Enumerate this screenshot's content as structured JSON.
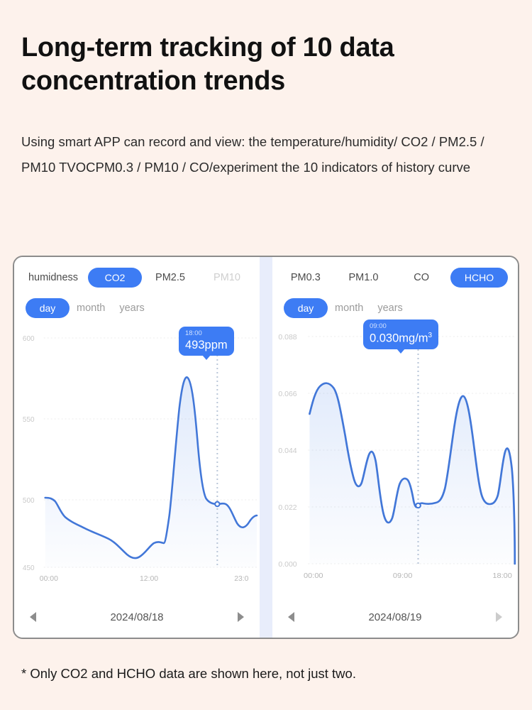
{
  "headline": "Long-term tracking of 10 data concentration trends",
  "subtext": "Using smart APP can record and view: the temperature/humidity/ CO2 / PM2.5 / PM10 TVOCPM0.3 / PM10 / CO/experiment the 10 indicators of history curve",
  "footnote": "* Only CO2 and HCHO data are shown here, not just two.",
  "colors": {
    "accent": "#3d7cf4",
    "curve": "#4277d8",
    "page_background": "#fdf2ec",
    "panel_background": "#ffffff",
    "divider": "#e8edfb",
    "axis_label": "#c9c9c9"
  },
  "left_panel": {
    "metric_tabs": [
      {
        "label": "humidness",
        "active": false,
        "faded": false
      },
      {
        "label": "CO2",
        "active": true,
        "faded": false
      },
      {
        "label": "PM2.5",
        "active": false,
        "faded": false
      },
      {
        "label": "PM10",
        "active": false,
        "faded": true
      }
    ],
    "range_tabs": [
      {
        "label": "day",
        "active": true
      },
      {
        "label": "month",
        "active": false
      },
      {
        "label": "years",
        "active": false
      }
    ],
    "tooltip": {
      "time": "18:00",
      "value": "493ppm"
    },
    "date": "2024/08/18",
    "prev_arrow": "triangle-left",
    "next_arrow": "triangle-right"
  },
  "right_panel": {
    "metric_tabs": [
      {
        "label": "PM0.3",
        "active": false,
        "faded": false
      },
      {
        "label": "PM1.0",
        "active": false,
        "faded": false
      },
      {
        "label": "CO",
        "active": false,
        "faded": false
      },
      {
        "label": "HCHO",
        "active": true,
        "faded": false
      }
    ],
    "range_tabs": [
      {
        "label": "day",
        "active": true
      },
      {
        "label": "month",
        "active": false
      },
      {
        "label": "years",
        "active": false
      }
    ],
    "tooltip": {
      "time": "09:00",
      "value": "0.030mg/m",
      "superscript": "3"
    },
    "date": "2024/08/19",
    "prev_arrow": "triangle-left",
    "next_arrow": "triangle-right"
  },
  "chart_data": [
    {
      "id": "co2-chart",
      "type": "line",
      "title": "CO2",
      "unit": "ppm",
      "xlabel": "",
      "ylabel": "",
      "ylim": [
        450,
        600
      ],
      "yticks": [
        600,
        550,
        500,
        450
      ],
      "ytick_labels": [
        "600",
        "550",
        "500",
        "450"
      ],
      "xticks": [
        0,
        12,
        23
      ],
      "xtick_labels": [
        "00:00",
        "12:00",
        "23:0"
      ],
      "grid": true,
      "legend": "none",
      "marker": {
        "x_label": "18:00",
        "x_hours": 18,
        "y": 493,
        "label": "493ppm"
      },
      "x": [
        0,
        0.7,
        1.4,
        2.2,
        3.2,
        4.4,
        5.6,
        6.8,
        8.0,
        9.0,
        9.9,
        10.8,
        11.6,
        12.4,
        13.2,
        13.9,
        14.5,
        15.0,
        15.4,
        15.8,
        16.2,
        16.7,
        17.2,
        17.6,
        18.0,
        18.5,
        19.2,
        20.0,
        20.8,
        21.6,
        22.3,
        23.0
      ],
      "values": [
        501,
        501,
        500,
        496,
        492,
        489,
        486,
        484,
        481,
        479,
        477,
        478,
        481,
        484,
        485,
        484,
        487,
        510,
        545,
        562,
        558,
        535,
        505,
        495,
        493,
        492,
        493,
        490,
        485,
        482,
        488,
        490
      ]
    },
    {
      "id": "hcho-chart",
      "type": "line",
      "title": "HCHO",
      "unit": "mg/m3",
      "xlabel": "",
      "ylabel": "",
      "ylim": [
        0.0,
        0.088
      ],
      "yticks": [
        0.088,
        0.066,
        0.044,
        0.022,
        0.0
      ],
      "ytick_labels": [
        "0.088",
        "0.066",
        "0.044",
        "0.022",
        "0.000"
      ],
      "xticks": [
        0,
        9,
        18
      ],
      "xtick_labels": [
        "00:00",
        "09:00",
        "18:00"
      ],
      "grid": true,
      "legend": "none",
      "marker": {
        "x_label": "09:00",
        "x_hours": 9,
        "y": 0.03,
        "label": "0.030mg/m3"
      },
      "x": [
        0,
        0.5,
        1.0,
        1.6,
        2.3,
        2.9,
        3.4,
        3.8,
        4.2,
        4.7,
        5.2,
        5.7,
        6.2,
        6.7,
        7.2,
        7.8,
        8.4,
        9.0,
        9.6,
        10.2,
        10.8,
        11.4,
        12.0,
        12.6,
        13.2,
        13.8,
        14.4,
        15.0,
        15.6,
        16.1,
        16.6,
        17.1,
        17.6,
        18.0
      ],
      "values": [
        0.058,
        0.066,
        0.07,
        0.07,
        0.064,
        0.048,
        0.033,
        0.032,
        0.04,
        0.05,
        0.033,
        0.014,
        0.026,
        0.046,
        0.048,
        0.046,
        0.034,
        0.03,
        0.031,
        0.031,
        0.034,
        0.048,
        0.062,
        0.069,
        0.068,
        0.058,
        0.04,
        0.031,
        0.031,
        0.04,
        0.055,
        0.044,
        0.022,
        0.0
      ]
    }
  ]
}
